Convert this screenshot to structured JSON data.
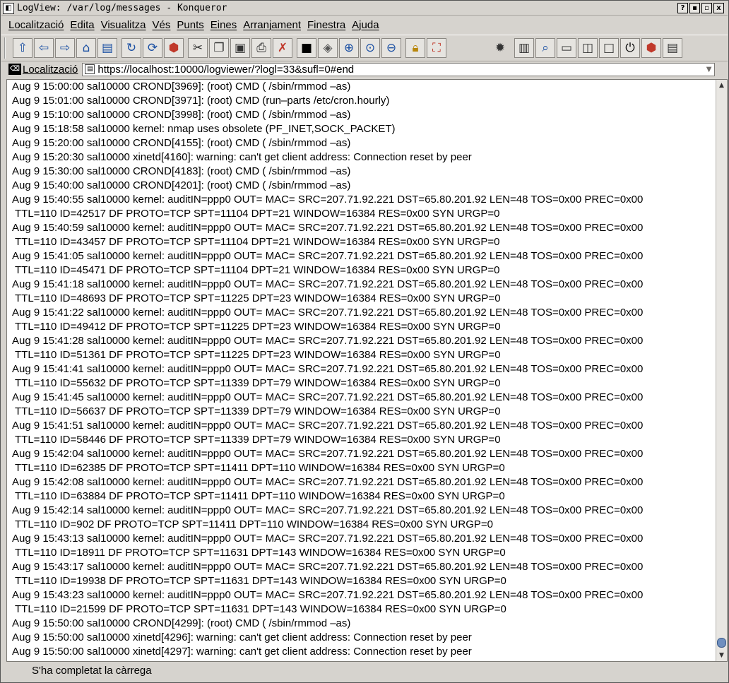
{
  "window": {
    "title": "LogView: /var/log/messages - Konqueror",
    "buttons": [
      "?",
      "▪",
      "▫",
      "x"
    ]
  },
  "menu": [
    "Localització",
    "Edita",
    "Visualitza",
    "Vés",
    "Punts",
    "Eines",
    "Arranjament",
    "Finestra",
    "Ajuda"
  ],
  "toolbar": {
    "icons": [
      "up-icon",
      "back-icon",
      "forward-icon",
      "home-icon",
      "bookmark-icon",
      "reload-icon",
      "refresh-icon",
      "stop-icon",
      "cut-icon",
      "copy-icon",
      "paste-icon",
      "print-icon",
      "delete-icon",
      "terminal-icon",
      "open-icon",
      "zoom-in-icon",
      "zoom-icon",
      "zoom-out-icon",
      "lock-icon",
      "fullscreen-icon",
      "settings-icon",
      "view-icon",
      "find-icon",
      "new-window-icon",
      "split-icon",
      "blank-icon",
      "power-icon",
      "gear-icon",
      "edit-icon"
    ]
  },
  "location": {
    "label": "Localització",
    "url": "https://localhost:10000/logviewer/?logl=33&sufl=0#end"
  },
  "log": [
    "Aug  9 15:00:00 sal10000 CROND[3969]: (root) CMD (    /sbin/rmmod –as)",
    "Aug  9 15:01:00 sal10000 CROND[3971]: (root) CMD (run–parts /etc/cron.hourly)",
    "Aug  9 15:10:00 sal10000 CROND[3998]: (root) CMD (    /sbin/rmmod –as)",
    "Aug  9 15:18:58 sal10000 kernel: nmap uses obsolete (PF_INET,SOCK_PACKET)",
    "Aug  9 15:20:00 sal10000 CROND[4155]: (root) CMD (    /sbin/rmmod –as)",
    "Aug  9 15:20:30 sal10000 xinetd[4160]: warning: can't get client address: Connection reset by peer",
    "Aug  9 15:30:00 sal10000 CROND[4183]: (root) CMD (    /sbin/rmmod –as)",
    "Aug  9 15:40:00 sal10000 CROND[4201]: (root) CMD (    /sbin/rmmod –as)",
    "Aug  9 15:40:55 sal10000 kernel: auditIN=ppp0 OUT= MAC= SRC=207.71.92.221 DST=65.80.201.92 LEN=48 TOS=0x00 PREC=0x00",
    "TTL=110 ID=42517 DF PROTO=TCP SPT=11104 DPT=21 WINDOW=16384 RES=0x00 SYN URGP=0",
    "Aug  9 15:40:59 sal10000 kernel: auditIN=ppp0 OUT= MAC= SRC=207.71.92.221 DST=65.80.201.92 LEN=48 TOS=0x00 PREC=0x00",
    "TTL=110 ID=43457 DF PROTO=TCP SPT=11104 DPT=21 WINDOW=16384 RES=0x00 SYN URGP=0",
    "Aug  9 15:41:05 sal10000 kernel: auditIN=ppp0 OUT= MAC= SRC=207.71.92.221 DST=65.80.201.92 LEN=48 TOS=0x00 PREC=0x00",
    "TTL=110 ID=45471 DF PROTO=TCP SPT=11104 DPT=21 WINDOW=16384 RES=0x00 SYN URGP=0",
    "Aug  9 15:41:18 sal10000 kernel: auditIN=ppp0 OUT= MAC= SRC=207.71.92.221 DST=65.80.201.92 LEN=48 TOS=0x00 PREC=0x00",
    "TTL=110 ID=48693 DF PROTO=TCP SPT=11225 DPT=23 WINDOW=16384 RES=0x00 SYN URGP=0",
    "Aug  9 15:41:22 sal10000 kernel: auditIN=ppp0 OUT= MAC= SRC=207.71.92.221 DST=65.80.201.92 LEN=48 TOS=0x00 PREC=0x00",
    "TTL=110 ID=49412 DF PROTO=TCP SPT=11225 DPT=23 WINDOW=16384 RES=0x00 SYN URGP=0",
    "Aug  9 15:41:28 sal10000 kernel: auditIN=ppp0 OUT= MAC= SRC=207.71.92.221 DST=65.80.201.92 LEN=48 TOS=0x00 PREC=0x00",
    "TTL=110 ID=51361 DF PROTO=TCP SPT=11225 DPT=23 WINDOW=16384 RES=0x00 SYN URGP=0",
    "Aug  9 15:41:41 sal10000 kernel: auditIN=ppp0 OUT= MAC= SRC=207.71.92.221 DST=65.80.201.92 LEN=48 TOS=0x00 PREC=0x00",
    "TTL=110 ID=55632 DF PROTO=TCP SPT=11339 DPT=79 WINDOW=16384 RES=0x00 SYN URGP=0",
    "Aug  9 15:41:45 sal10000 kernel: auditIN=ppp0 OUT= MAC= SRC=207.71.92.221 DST=65.80.201.92 LEN=48 TOS=0x00 PREC=0x00",
    "TTL=110 ID=56637 DF PROTO=TCP SPT=11339 DPT=79 WINDOW=16384 RES=0x00 SYN URGP=0",
    "Aug  9 15:41:51 sal10000 kernel: auditIN=ppp0 OUT= MAC= SRC=207.71.92.221 DST=65.80.201.92 LEN=48 TOS=0x00 PREC=0x00",
    "TTL=110 ID=58446 DF PROTO=TCP SPT=11339 DPT=79 WINDOW=16384 RES=0x00 SYN URGP=0",
    "Aug  9 15:42:04 sal10000 kernel: auditIN=ppp0 OUT= MAC= SRC=207.71.92.221 DST=65.80.201.92 LEN=48 TOS=0x00 PREC=0x00",
    "TTL=110 ID=62385 DF PROTO=TCP SPT=11411 DPT=110 WINDOW=16384 RES=0x00 SYN URGP=0",
    "Aug  9 15:42:08 sal10000 kernel: auditIN=ppp0 OUT= MAC= SRC=207.71.92.221 DST=65.80.201.92 LEN=48 TOS=0x00 PREC=0x00",
    "TTL=110 ID=63884 DF PROTO=TCP SPT=11411 DPT=110 WINDOW=16384 RES=0x00 SYN URGP=0",
    "Aug  9 15:42:14 sal10000 kernel: auditIN=ppp0 OUT= MAC= SRC=207.71.92.221 DST=65.80.201.92 LEN=48 TOS=0x00 PREC=0x00",
    "TTL=110 ID=902 DF PROTO=TCP SPT=11411 DPT=110 WINDOW=16384 RES=0x00 SYN URGP=0",
    "Aug  9 15:43:13 sal10000 kernel: auditIN=ppp0 OUT= MAC= SRC=207.71.92.221 DST=65.80.201.92 LEN=48 TOS=0x00 PREC=0x00",
    "TTL=110 ID=18911 DF PROTO=TCP SPT=11631 DPT=143 WINDOW=16384 RES=0x00 SYN URGP=0",
    "Aug  9 15:43:17 sal10000 kernel: auditIN=ppp0 OUT= MAC= SRC=207.71.92.221 DST=65.80.201.92 LEN=48 TOS=0x00 PREC=0x00",
    "TTL=110 ID=19938 DF PROTO=TCP SPT=11631 DPT=143 WINDOW=16384 RES=0x00 SYN URGP=0",
    "Aug  9 15:43:23 sal10000 kernel: auditIN=ppp0 OUT= MAC= SRC=207.71.92.221 DST=65.80.201.92 LEN=48 TOS=0x00 PREC=0x00",
    "TTL=110 ID=21599 DF PROTO=TCP SPT=11631 DPT=143 WINDOW=16384 RES=0x00 SYN URGP=0",
    "Aug  9 15:50:00 sal10000 CROND[4299]: (root) CMD (    /sbin/rmmod –as)",
    "Aug  9 15:50:00 sal10000 xinetd[4296]: warning: can't get client address: Connection reset by peer",
    "Aug  9 15:50:00 sal10000 xinetd[4297]: warning: can't get client address: Connection reset by peer"
  ],
  "status": "S'ha completat la càrrega"
}
